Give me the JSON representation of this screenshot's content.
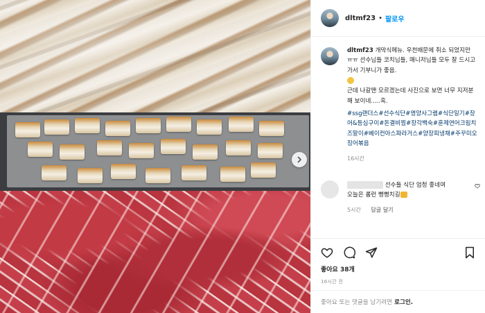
{
  "post": {
    "username": "dltmf23",
    "separator": "•",
    "follow_label": "팔로우"
  },
  "caption": {
    "username": "dltmf23",
    "text1": "개막식메뉴. 우천때문에 취소 되었지만 ㅠㅠ 선수님들 코치님들, 매니저님들 모두 잘 드시고 가서 기부니가 좋음.",
    "text2": "근데 나갈땐 모르겠는데 사진으로 보면 너무 지저분해 보이네.....흑.",
    "hashtags": "#ssg랜더스#선수식단#영양사그램#식단일기#장어&등심구이#돈결비찜#장각백숙#훈제연어크림치즈말이#베이컨아스파라거스#양장피냉채#주꾸미오징어볶음",
    "time": "16시간"
  },
  "comment": {
    "text1": "선수들 식단 엄청 좋네여",
    "text2": "오늘은 롬런 뻥뻥치길",
    "time": "5시간",
    "reply_label": "답글 달기"
  },
  "engagement": {
    "likes_label": "좋아요 38개",
    "post_time": "16시간 전"
  },
  "add_comment": {
    "prompt": "좋아요 또는 댓글을 남기려면",
    "login_label": "로그인."
  },
  "icons": {
    "like": "heart-icon",
    "comment": "comment-icon",
    "share": "share-icon",
    "save": "bookmark-icon",
    "next": "chevron-right-icon"
  },
  "colors": {
    "link_blue": "#0095f6",
    "hashtag": "#00376b",
    "muted": "#8e8e8e"
  }
}
